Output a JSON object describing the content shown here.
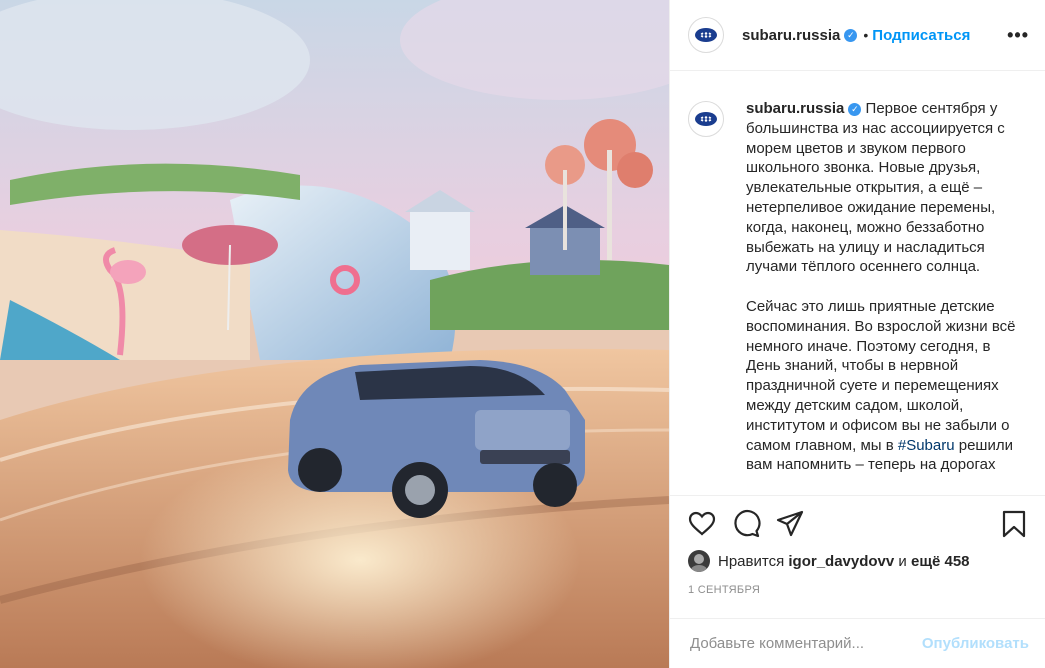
{
  "post": {
    "username": "subaru.russia",
    "follow_label": "Подписаться",
    "separator": "•",
    "more_label": "•••",
    "verified_mark": "✓",
    "caption_p1": "Первое сентября у большинства из нас ассоциируется с морем цветов и звуком первого школьного звонка. Новые друзья, увлекательные открытия, а ещё – нетерпеливое ожидание перемены, когда, наконец, можно беззаботно выбежать на улицу и насладиться лучами тёплого осеннего солнца.",
    "caption_p2_before": "Сейчас это лишь приятные детские воспоминания. Во взрослой жизни всё немного иначе. Поэтому сегодня, в День знаний, чтобы в нервной праздничной суете и перемещениях между детским садом, школой, институтом и офисом вы не забыли о самом главном, мы в",
    "caption_hashtag": "#Subaru",
    "caption_p2_after": "решили вам напомнить – теперь на дорогах",
    "likes_prefix": "Нравится",
    "likes_user": "igor_davydovv",
    "likes_and": "и",
    "likes_more": "ещё 458",
    "date": "1 СЕНТЯБРЯ",
    "comment_placeholder": "Добавьте комментарий...",
    "publish_label": "Опубликовать"
  },
  "icons": [
    "heart-icon",
    "comment-icon",
    "share-icon",
    "bookmark-icon",
    "verified-badge-icon",
    "more-options-icon"
  ],
  "colors": {
    "accent": "#0095f6",
    "verified": "#3897f0",
    "publish_disabled": "#b2dffc",
    "text": "#262626",
    "muted": "#8e8e8e"
  }
}
